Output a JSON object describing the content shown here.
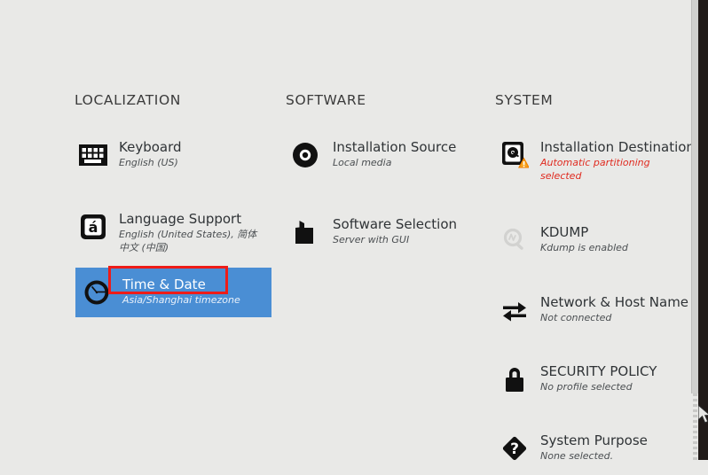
{
  "window": {
    "background_color": "#e9e9e7",
    "selection_color": "#4a8ed4",
    "warning_color": "#e02b20",
    "annotation_color": "#ee1c18"
  },
  "columns": [
    {
      "id": "localization",
      "header": "LOCALIZATION",
      "items": [
        {
          "title": "Keyboard",
          "subtitle": "English (US)",
          "icon": "keyboard-icon",
          "selected": false,
          "warning": false,
          "disabled": false
        },
        {
          "title": "Language Support",
          "subtitle": "English (United States), 简体中文 (中国)",
          "icon": "language-icon",
          "selected": false,
          "warning": false,
          "disabled": false
        },
        {
          "title": "Time & Date",
          "subtitle": "Asia/Shanghai timezone",
          "icon": "clock-icon",
          "selected": true,
          "warning": false,
          "disabled": false
        }
      ]
    },
    {
      "id": "software",
      "header": "SOFTWARE",
      "items": [
        {
          "title": "Installation Source",
          "subtitle": "Local media",
          "icon": "disc-icon",
          "selected": false,
          "warning": false,
          "disabled": false
        },
        {
          "title": "Software Selection",
          "subtitle": "Server with GUI",
          "icon": "package-icon",
          "selected": false,
          "warning": false,
          "disabled": false
        }
      ]
    },
    {
      "id": "system",
      "header": "SYSTEM",
      "items": [
        {
          "title": "Installation Destination",
          "subtitle": "Automatic partitioning selected",
          "icon": "harddrive-icon",
          "badge": "warning-triangle-icon",
          "selected": false,
          "warning": true,
          "disabled": false
        },
        {
          "title": "KDUMP",
          "subtitle": "Kdump is enabled",
          "icon": "kdump-magnifier-icon",
          "selected": false,
          "warning": false,
          "disabled": true
        },
        {
          "title": "Network & Host Name",
          "subtitle": "Not connected",
          "icon": "network-arrows-icon",
          "selected": false,
          "warning": false,
          "disabled": false
        },
        {
          "title": "SECURITY POLICY",
          "subtitle": "No profile selected",
          "icon": "padlock-icon",
          "selected": false,
          "warning": false,
          "disabled": false
        },
        {
          "title": "System Purpose",
          "subtitle": "None selected.",
          "icon": "question-diamond-icon",
          "selected": false,
          "warning": false,
          "disabled": false
        }
      ]
    }
  ]
}
